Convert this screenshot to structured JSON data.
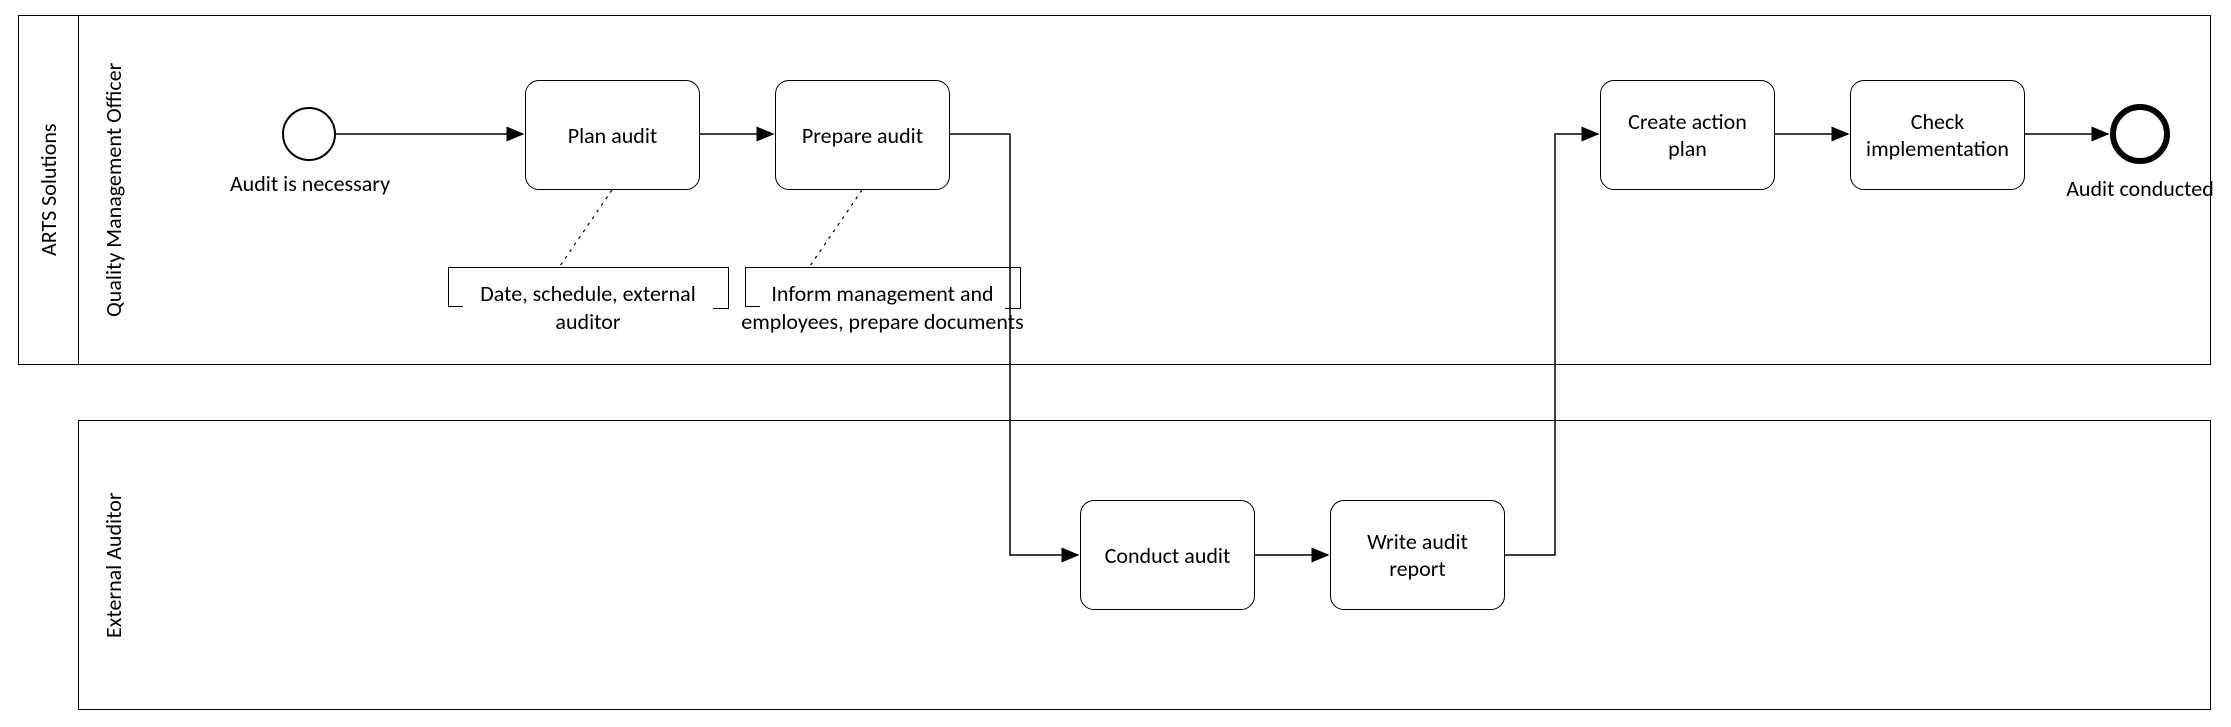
{
  "pool": {
    "title": "ARTS Solutions",
    "lanes": [
      {
        "id": "qmo",
        "title": "Quality Management Officer"
      },
      {
        "id": "ext",
        "title": "External Auditor"
      }
    ]
  },
  "events": {
    "start": {
      "label": "Audit is necessary"
    },
    "end": {
      "label": "Audit conducted"
    }
  },
  "tasks": {
    "plan": {
      "label": "Plan audit"
    },
    "prepare": {
      "label": "Prepare audit"
    },
    "conduct": {
      "label": "Conduct audit"
    },
    "writeReport": {
      "label": "Write audit report"
    },
    "createPlan": {
      "label": "Create action plan"
    },
    "checkImpl": {
      "label": "Check implementation"
    }
  },
  "annotations": {
    "planNote": "Date, schedule, external auditor",
    "prepareNote": "Inform management and employees, prepare documents"
  },
  "chart_data": {
    "type": "bpmn",
    "pools": [
      {
        "name": "ARTS Solutions",
        "lanes": [
          {
            "name": "Quality Management Officer",
            "elements": [
              {
                "id": "start",
                "type": "startEvent",
                "label": "Audit is necessary"
              },
              {
                "id": "plan",
                "type": "task",
                "label": "Plan audit",
                "annotation": "Date, schedule, external auditor"
              },
              {
                "id": "prepare",
                "type": "task",
                "label": "Prepare audit",
                "annotation": "Inform management and employees, prepare documents"
              },
              {
                "id": "createPlan",
                "type": "task",
                "label": "Create action plan"
              },
              {
                "id": "checkImpl",
                "type": "task",
                "label": "Check implementation"
              },
              {
                "id": "end",
                "type": "endEvent",
                "label": "Audit conducted"
              }
            ]
          }
        ]
      },
      {
        "name": "External Auditor",
        "lanes": [
          {
            "name": "External Auditor",
            "elements": [
              {
                "id": "conduct",
                "type": "task",
                "label": "Conduct audit"
              },
              {
                "id": "writeReport",
                "type": "task",
                "label": "Write audit report"
              }
            ]
          }
        ]
      }
    ],
    "sequenceFlows": [
      {
        "from": "start",
        "to": "plan"
      },
      {
        "from": "plan",
        "to": "prepare"
      },
      {
        "from": "prepare",
        "to": "conduct"
      },
      {
        "from": "conduct",
        "to": "writeReport"
      },
      {
        "from": "writeReport",
        "to": "createPlan"
      },
      {
        "from": "createPlan",
        "to": "checkImpl"
      },
      {
        "from": "checkImpl",
        "to": "end"
      }
    ]
  }
}
